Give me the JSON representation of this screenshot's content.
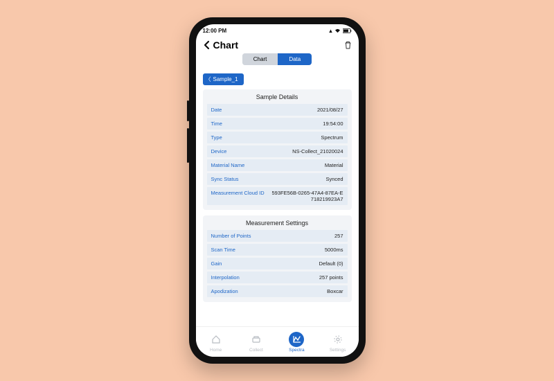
{
  "status": {
    "time": "12:00 PM"
  },
  "header": {
    "title": "Chart"
  },
  "segments": {
    "chart": "Chart",
    "data": "Data"
  },
  "chip": {
    "label": "Sample_1"
  },
  "sample_details": {
    "title": "Sample Details",
    "rows": {
      "date": {
        "label": "Date",
        "value": "2021/08/27"
      },
      "time": {
        "label": "Time",
        "value": "19:54:00"
      },
      "type": {
        "label": "Type",
        "value": "Spectrum"
      },
      "device": {
        "label": "Device",
        "value": "NS-Collect_21020024"
      },
      "material": {
        "label": "Material Name",
        "value": "Material"
      },
      "sync": {
        "label": "Sync Status",
        "value": "Synced"
      },
      "cloud": {
        "label": "Measurement Cloud ID",
        "value": "593FE56B-0265-47A4-87EA-E718219923A7"
      }
    }
  },
  "measurement_settings": {
    "title": "Measurement Settings",
    "rows": {
      "points": {
        "label": "Number of Points",
        "value": "257"
      },
      "scan": {
        "label": "Scan Time",
        "value": "5000ms"
      },
      "gain": {
        "label": "Gain",
        "value": "Default (0)"
      },
      "interp": {
        "label": "Interpolation",
        "value": "257 points"
      },
      "apod": {
        "label": "Apodization",
        "value": "Boxcar"
      }
    }
  },
  "tabs": {
    "home": "Home",
    "collect": "Collect",
    "spectra": "Spectra",
    "settings": "Settings"
  }
}
